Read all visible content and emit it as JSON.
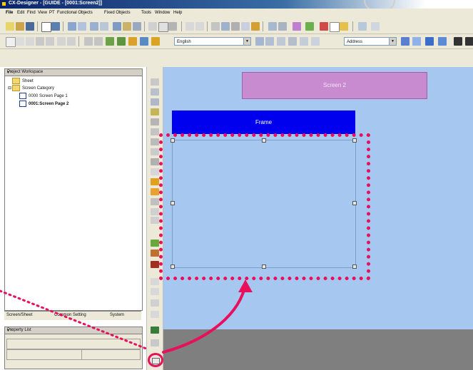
{
  "window": {
    "title": "CX-Designer - [GUIDE - [0001:Screen2]]"
  },
  "menu": [
    "File",
    "Edit",
    "Find",
    "View",
    "PT",
    "Functional Objects",
    "Fixed Objects",
    "Tools",
    "Window",
    "Help"
  ],
  "toolbar2": {
    "language": "English",
    "address": "Address"
  },
  "workspace": {
    "title": "Project Workspace",
    "controls": "▾ ×",
    "tree": {
      "sheet": "Sheet",
      "screen_category": "Screen Category",
      "page1": "0000 Screen Page 1",
      "page2": "0001:Screen Page 2"
    }
  },
  "tabs": [
    "Screen/Sheet",
    "Common Setting",
    "System"
  ],
  "property_list": {
    "title": "Property List",
    "controls": "▾ ×"
  },
  "canvas": {
    "screen_label": "Screen 2",
    "frame_label": "Frame"
  },
  "colors": {
    "highlight": "#e8105c",
    "canvas_bg": "#a6c8f0",
    "frame_header": "#0000ee",
    "screen_label_bg": "#c98bd0"
  },
  "icons": [
    "folder-icon",
    "page-icon",
    "frame-tool-icon",
    "arrow-annotation-icon"
  ]
}
